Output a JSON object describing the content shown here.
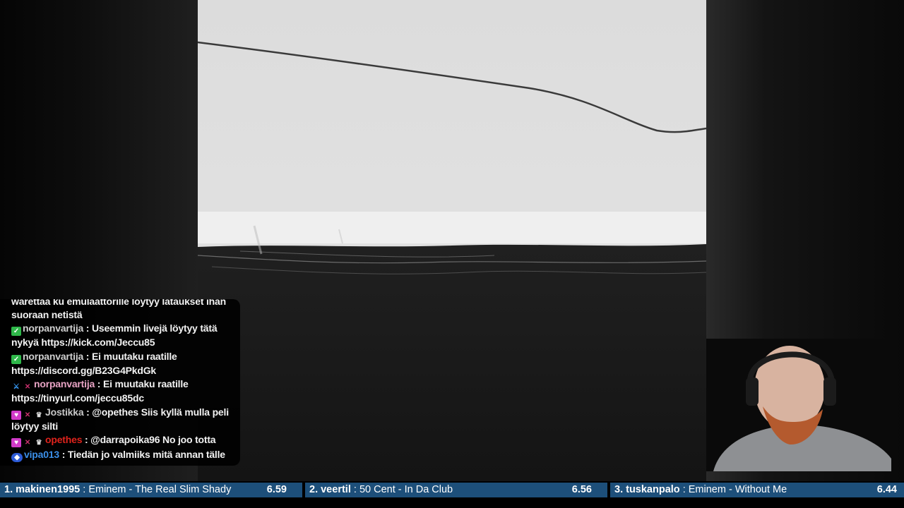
{
  "chat": {
    "messages": [
      {
        "user": "",
        "badges": [],
        "user_color": "#f2f2f2",
        "text": "warettaa ku emulaattorille löytyy lataukset ihan suoraan netistä"
      },
      {
        "user": "norpanvartija",
        "badges": [
          "check"
        ],
        "user_color": "#cfcfcf",
        "text": ": Useemmin livejä löytyy tätä nykyä https://kick.com/Jeccu85"
      },
      {
        "user": "norpanvartija",
        "badges": [
          "check"
        ],
        "user_color": "#cfcfcf",
        "text": ": Ei muutaku raatille https://discord.gg/B23G4PkdGk"
      },
      {
        "user": "norpanvartija",
        "badges": [
          "sword",
          "cross"
        ],
        "user_color": "#e8a3c4",
        "text": ": Ei muutaku raatille https://tinyurl.com/jeccu85dc"
      },
      {
        "user": "Jostikka",
        "badges": [
          "heart",
          "cross",
          "crown"
        ],
        "user_color": "#c8c8c8",
        "text": ": @opethes Siis kyllä mulla peli löytyy silti"
      },
      {
        "user": "opethes",
        "badges": [
          "heart",
          "cross",
          "crown"
        ],
        "user_color": "#e0231c",
        "text": ": @darrapoika96 No joo totta"
      },
      {
        "user": "vipa013",
        "badges": [
          "blue"
        ],
        "user_color": "#3b8fe8",
        "text": ": Tiedän jo valmiiks mitä annan tälle"
      }
    ]
  },
  "ticker": {
    "entries": [
      {
        "rank": "1. makinen1995",
        "sep": " : ",
        "song": "Eminem - The Real Slim Shady",
        "score": "6.59"
      },
      {
        "rank": "2. veertil",
        "sep": " : ",
        "song": "50 Cent - In Da Club",
        "score": "6.56"
      },
      {
        "rank": "3. tuskanpalo",
        "sep": " : ",
        "song": "Eminem - Without Me",
        "score": "6.44"
      }
    ],
    "bar_color": "#1d4f7a"
  },
  "icons": {
    "check": "check-badge-icon",
    "sword": "sword-badge-icon",
    "cross": "crossed-swords-icon",
    "crown": "crown-badge-icon",
    "heart": "heart-badge-icon",
    "blue": "partner-badge-icon"
  }
}
